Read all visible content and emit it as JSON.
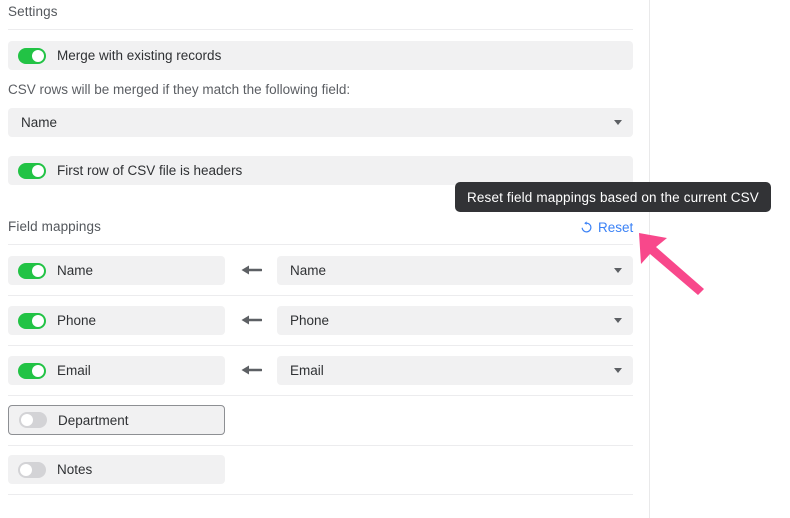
{
  "theme": {
    "accent_blue": "#3b82f6",
    "toggle_on_green": "#22c345",
    "toggle_off_grey": "#d3d3d6",
    "row_bg": "#f1f1f2",
    "tooltip_bg": "#323336",
    "annotation_pink": "#f8488b",
    "divider": "#ececee",
    "text": "#2f3134"
  },
  "settings": {
    "heading": "Settings",
    "merge_toggle": {
      "label": "Merge with existing records",
      "state": "on"
    },
    "merge_helper_text": "CSV rows will be merged if they match the following field:",
    "match_field_select": {
      "value": "Name",
      "caret": "chevron-down-icon"
    },
    "headers_toggle": {
      "label": "First row of CSV file is headers",
      "state": "on"
    }
  },
  "field_mappings": {
    "heading": "Field mappings",
    "reset": {
      "label": "Reset",
      "icon": "reset-circular-arrow-icon",
      "tooltip": "Reset field mappings based on the current CSV"
    },
    "rows": [
      {
        "field_label": "Name",
        "toggle_state": "on",
        "has_mapping": true,
        "arrow_icon": "arrow-left-icon",
        "csv_column": "Name",
        "focused": false
      },
      {
        "field_label": "Phone",
        "toggle_state": "on",
        "has_mapping": true,
        "arrow_icon": "arrow-left-icon",
        "csv_column": "Phone",
        "focused": false
      },
      {
        "field_label": "Email",
        "toggle_state": "on",
        "has_mapping": true,
        "arrow_icon": "arrow-left-icon",
        "csv_column": "Email",
        "focused": false
      },
      {
        "field_label": "Department",
        "toggle_state": "off",
        "has_mapping": false,
        "arrow_icon": "",
        "csv_column": "",
        "focused": true
      },
      {
        "field_label": "Notes",
        "toggle_state": "off",
        "has_mapping": false,
        "arrow_icon": "",
        "csv_column": "",
        "focused": false
      }
    ]
  },
  "annotation": {
    "icon": "pink-pointer-arrow",
    "points_at": "Reset"
  }
}
